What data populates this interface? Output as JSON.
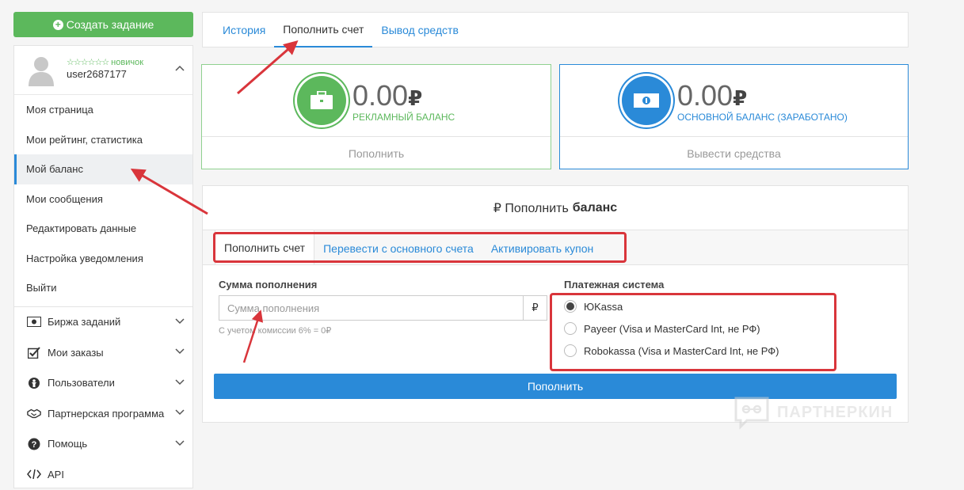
{
  "sidebar": {
    "create_button": "Создать задание",
    "rank_stars": "☆☆☆☆☆☆",
    "rank_label": "новичок",
    "username": "user2687177",
    "menu": [
      {
        "label": "Моя страница"
      },
      {
        "label": "Мои рейтинг, статистика"
      },
      {
        "label": "Мой баланс"
      },
      {
        "label": "Мои сообщения"
      },
      {
        "label": "Редактировать данные"
      },
      {
        "label": "Настройка уведомления"
      },
      {
        "label": "Выйти"
      }
    ],
    "sections": [
      {
        "label": "Биржа заданий",
        "icon": "money-icon"
      },
      {
        "label": "Мои заказы",
        "icon": "checkbox-icon"
      },
      {
        "label": "Пользователи",
        "icon": "users-icon"
      },
      {
        "label": "Партнерская программа",
        "icon": "handshake-icon"
      },
      {
        "label": "Помощь",
        "icon": "question-icon"
      },
      {
        "label": "API",
        "icon": "code-icon"
      }
    ]
  },
  "top_tabs": [
    {
      "label": "История"
    },
    {
      "label": "Пополнить счет"
    },
    {
      "label": "Вывод средств"
    }
  ],
  "cards": {
    "ad": {
      "amount": "0.00",
      "currency": "₽",
      "label": "РЕКЛАМНЫЙ БАЛАНС",
      "action": "Пополнить"
    },
    "main": {
      "amount": "0.00",
      "currency": "₽",
      "label": "ОСНОВНОЙ БАЛАНС (ЗАРАБОТАНО)",
      "action": "Вывести средства"
    }
  },
  "topup": {
    "title_prefix": "₽ Пополнить",
    "title_bold": "баланс",
    "tabs": [
      {
        "label": "Пополнить счет"
      },
      {
        "label": "Перевести с основного счета"
      },
      {
        "label": "Активировать купон"
      }
    ],
    "sum_label": "Сумма пополнения",
    "sum_placeholder": "Сумма пополнения",
    "currency_addon": "₽",
    "commission": "С учетом комиссии 6% = 0₽",
    "payment_label": "Платежная система",
    "payment_options": [
      {
        "label": "ЮKassa",
        "checked": true
      },
      {
        "label": "Payeer (Visa и MasterCard Int, не РФ)",
        "checked": false
      },
      {
        "label": "Robokassa (Visa и MasterCard Int, не РФ)",
        "checked": false
      }
    ],
    "submit": "Пополнить"
  },
  "watermark": "ПАРТНЕРКИН",
  "colors": {
    "accent": "#2a8ad8",
    "green": "#5cb85c",
    "highlight": "#d9353b"
  }
}
